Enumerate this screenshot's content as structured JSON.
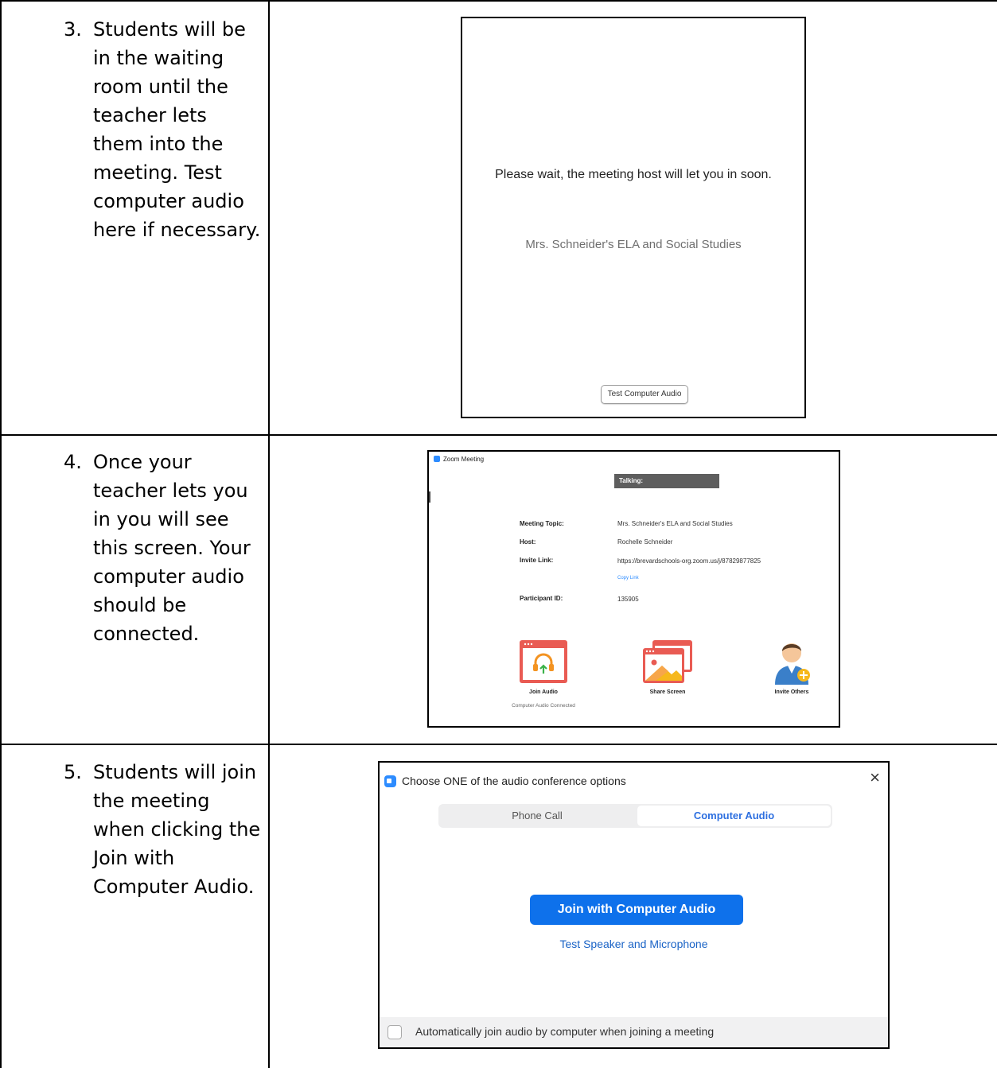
{
  "steps": [
    {
      "number": "3.",
      "text": "Students will be in the waiting room until the teacher lets them into the meeting. Test computer audio here if necessary."
    },
    {
      "number": "4.",
      "text": "Once your teacher lets you in you will see this screen. Your computer audio should be connected."
    },
    {
      "number": "5.",
      "text": "Students will join the meeting when clicking the Join with Computer Audio."
    }
  ],
  "waiting_room": {
    "message": "Please wait, the meeting host will let you in soon.",
    "topic": "Mrs. Schneider's ELA and Social Studies",
    "test_audio_button": "Test Computer Audio"
  },
  "meeting": {
    "window_title": "Zoom Meeting",
    "talking_label": "Talking:",
    "fields": [
      {
        "label": "Meeting Topic:",
        "value": "Mrs. Schneider's ELA and Social Studies"
      },
      {
        "label": "Host:",
        "value": "Rochelle Schneider"
      },
      {
        "label": "Invite Link:",
        "value": "https://brevardschools-org.zoom.us/j/87829877825"
      },
      {
        "label": "Participant ID:",
        "value": "135905"
      }
    ],
    "copy_link": "Copy Link",
    "tools": [
      {
        "label": "Join Audio",
        "icon": "headphones-icon",
        "sub": "Computer Audio Connected"
      },
      {
        "label": "Share Screen",
        "icon": "share-screen-icon"
      },
      {
        "label": "Invite Others",
        "icon": "invite-person-icon"
      }
    ],
    "colors": {
      "tool_red": "#e95b53",
      "headphone_orange": "#f39321",
      "arrow_green": "#3cb34a",
      "person_blue": "#3a7fc9",
      "plus_yellow": "#f6b81c"
    }
  },
  "audio_dialog": {
    "title": "Choose ONE of the audio conference options",
    "close": "×",
    "tabs": [
      "Phone Call",
      "Computer Audio"
    ],
    "active_tab": "Computer Audio",
    "join_button": "Join with Computer Audio",
    "test_link": "Test Speaker and Microphone",
    "auto_join_checkbox": "Automatically join audio by computer when joining a meeting",
    "auto_join_checked": false,
    "colors": {
      "accent": "#0e71eb"
    }
  }
}
